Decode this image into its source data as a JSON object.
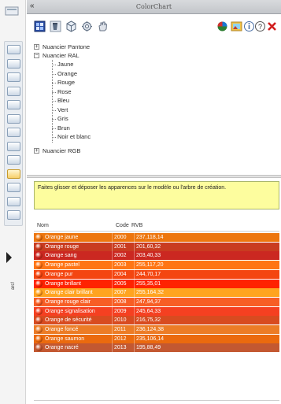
{
  "window": {
    "title": "ColorChart",
    "collapse_glyph": "«"
  },
  "sidebar": {
    "label": "arc!",
    "tools": [
      {
        "icon": "house-icon",
        "selected": false
      },
      {
        "icon": "cylinder-icon",
        "selected": false
      },
      {
        "icon": "sheet-icon",
        "selected": false
      },
      {
        "icon": "grid-icon",
        "selected": false
      },
      {
        "icon": "color-wheel-icon",
        "selected": false
      },
      {
        "icon": "document-icon",
        "selected": false
      },
      {
        "icon": "globe-icon",
        "selected": false
      },
      {
        "icon": "monitor-icon",
        "selected": false
      },
      {
        "icon": "table-icon",
        "selected": false
      },
      {
        "icon": "paint-drop-icon",
        "selected": true
      },
      {
        "icon": "people-icon",
        "selected": false
      },
      {
        "icon": "disc-icon",
        "selected": false
      },
      {
        "icon": "stack-icon",
        "selected": false
      }
    ]
  },
  "toolbar": {
    "left_icons": [
      "palette-view-icon",
      "bucket-icon",
      "cube-icon",
      "settings-icon",
      "hand-icon"
    ],
    "right_icons": [
      "globe-paint-icon",
      "picture-icon",
      "info-icon",
      "help-icon",
      "close-icon"
    ]
  },
  "tree": {
    "nodes": [
      {
        "label": "Nuancier Pantone",
        "expanded": false
      },
      {
        "label": "Nuancier RAL",
        "expanded": true,
        "children": [
          "Jaune",
          "Orange",
          "Rouge",
          "Rose",
          "Bleu",
          "Vert",
          "Gris",
          "Brun",
          "Noir et blanc"
        ]
      },
      {
        "label": "Nuancier RGB",
        "expanded": false
      }
    ]
  },
  "drop_hint": "Faites glisser et déposer les apparences sur le modèle ou l'arbre de création.",
  "list": {
    "headers": {
      "name": "Nom",
      "code": "Code",
      "rvb": "RVB"
    },
    "rows": [
      {
        "name": "Orange jaune",
        "code": "2000",
        "rvb": "237,118,14",
        "color": "#ed760e"
      },
      {
        "name": "Orange rouge",
        "code": "2001",
        "rvb": "201,60,32",
        "color": "#c93c20"
      },
      {
        "name": "Orange sang",
        "code": "2002",
        "rvb": "203,40,33",
        "color": "#cb2821"
      },
      {
        "name": "Orange pastel",
        "code": "2003",
        "rvb": "255,117,20",
        "color": "#ff7514"
      },
      {
        "name": "Orange pur",
        "code": "2004",
        "rvb": "244,70,17",
        "color": "#f44611"
      },
      {
        "name": "Orange brillant",
        "code": "2005",
        "rvb": "255,35,01",
        "color": "#ff2301"
      },
      {
        "name": "Orange clair brillant",
        "code": "2007",
        "rvb": "255,164,32",
        "color": "#ffa420"
      },
      {
        "name": "Orange rouge clair",
        "code": "2008",
        "rvb": "247,94,37",
        "color": "#f75e25"
      },
      {
        "name": "Orange signalisation",
        "code": "2009",
        "rvb": "245,64,33",
        "color": "#f54021"
      },
      {
        "name": "Orange de sécurité",
        "code": "2010",
        "rvb": "216,75,32",
        "color": "#d84b20"
      },
      {
        "name": "Orange foncé",
        "code": "2011",
        "rvb": "236,124,38",
        "color": "#ec7c26"
      },
      {
        "name": "Orange saumon",
        "code": "2012",
        "rvb": "235,106,14",
        "color": "#eb6a0e"
      },
      {
        "name": "Orange nacré",
        "code": "2013",
        "rvb": "195,88,49",
        "color": "#c35831"
      }
    ]
  }
}
